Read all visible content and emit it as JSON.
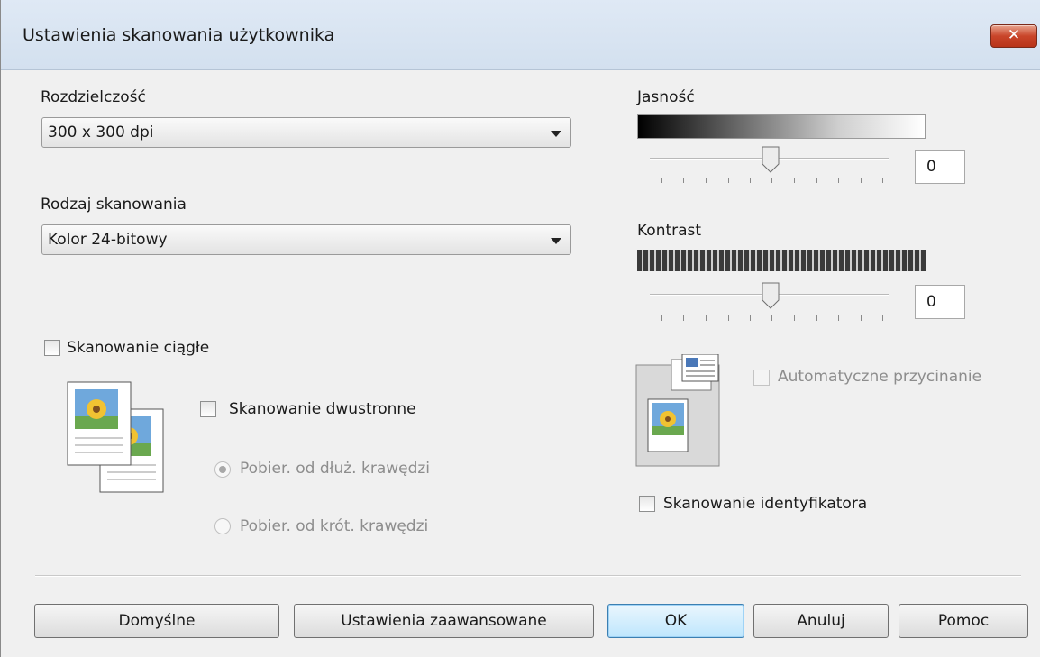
{
  "window": {
    "title": "Ustawienia skanowania użytkownika",
    "close_label": "✕"
  },
  "resolution": {
    "label": "Rozdzielczość",
    "value": "300 x 300 dpi"
  },
  "scan_type": {
    "label": "Rodzaj skanowania",
    "value": "Kolor 24-bitowy"
  },
  "continuous_scan": {
    "label": "Skanowanie ciągłe",
    "checked": false
  },
  "duplex": {
    "label": "Skanowanie dwustronne",
    "checked": false,
    "long_edge_label": "Pobier. od dłuż. krawędzi",
    "short_edge_label": "Pobier. od krót. krawędzi",
    "selected": "long_edge"
  },
  "brightness": {
    "label": "Jasność",
    "value": "0"
  },
  "contrast": {
    "label": "Kontrast",
    "value": "0"
  },
  "auto_crop": {
    "label": "Automatyczne przycinanie",
    "checked": false,
    "enabled": false
  },
  "id_card_scan": {
    "label": "Skanowanie identyfikatora",
    "checked": false
  },
  "buttons": {
    "defaults": "Domyślne",
    "advanced": "Ustawienia zaawansowane",
    "ok": "OK",
    "cancel": "Anuluj",
    "help": "Pomoc"
  },
  "colors": {
    "title_bar": "#d3e0ef",
    "close_button": "#c9452a",
    "default_button": "#bee6fd",
    "dialog_bg": "#f0f0f0"
  }
}
